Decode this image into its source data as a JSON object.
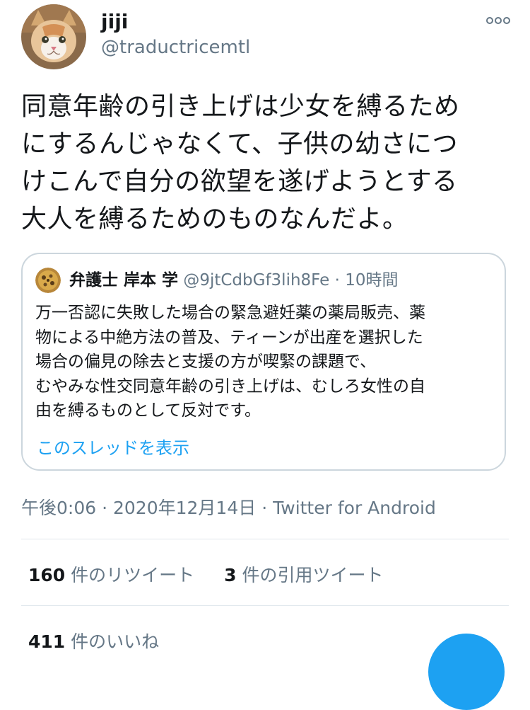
{
  "tweet": {
    "author": {
      "display_name": "jiji",
      "handle": "@traductricemtl"
    },
    "more_icon": "more-dots-icon",
    "text": "同意年齢の引き上げは少女を縛るため\nにするんじゃなくて、子供の幼さにつ\nけこんで自分の欲望を遂げようとする\n大人を縛るためのものなんだよ。",
    "quoted": {
      "author_name": "弁護士 岸本 学",
      "handle": "@9jtCdbGf3lih8Fe",
      "separator": "·",
      "time": "10時間",
      "text": "万一否認に失敗した場合の緊急避妊薬の薬局販売、薬\n物による中絶方法の普及、ティーンが出産を選択した\n場合の偏見の除去と支援の方が喫緊の課題で、\nむやみな性交同意年齢の引き上げは、むしろ女性の自\n由を縛るものとして反対です。",
      "show_thread": "このスレッドを表示"
    },
    "meta": {
      "time": "午後0:06",
      "dot1": "·",
      "date": "2020年12月14日",
      "dot2": "·",
      "source": "Twitter for Android"
    },
    "stats": {
      "retweets_count": "160",
      "retweets_label": "件のリツイート",
      "quotes_count": "3",
      "quotes_label": "件の引用ツイート",
      "likes_count": "411",
      "likes_label": "件のいいね"
    }
  },
  "colors": {
    "text": "#14171a",
    "secondary": "#657786",
    "link": "#1da1f2",
    "border": "#ccd6dd",
    "divider": "#e1e8ed"
  }
}
